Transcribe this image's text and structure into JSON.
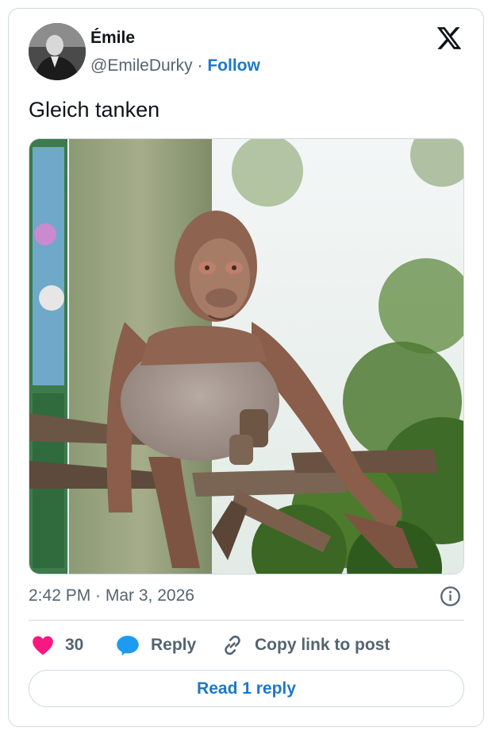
{
  "author": {
    "display_name": "Émile",
    "handle": "@EmileDurky",
    "separator": "·",
    "follow_label": "Follow"
  },
  "tweet": {
    "text": "Gleich tanken",
    "timestamp": "2:42 PM · Mar 3, 2026"
  },
  "actions": {
    "like_count": "30",
    "reply_label": "Reply",
    "copy_link_label": "Copy link to post"
  },
  "read_replies_label": "Read 1 reply",
  "colors": {
    "accent": "#1d77c8",
    "like": "#f91880",
    "reply": "#1d9bf0",
    "muted_text": "#536471",
    "border": "#cfd9de"
  },
  "icons": [
    "x-logo-icon",
    "info-icon",
    "heart-icon",
    "reply-bubble-icon",
    "link-icon"
  ]
}
